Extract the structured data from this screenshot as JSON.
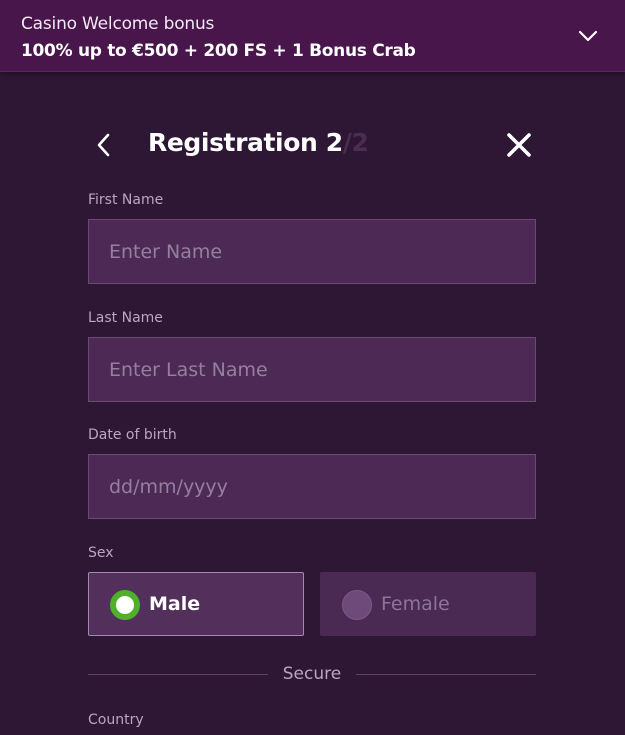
{
  "banner": {
    "title": "Casino Welcome bonus",
    "offer": "100% up to €500 + 200 FS + 1 Bonus Crab",
    "icon": "chevron-down-icon"
  },
  "header": {
    "title": "Registration",
    "step_current": "2",
    "step_total": "/2",
    "back_icon": "chevron-left-icon",
    "close_icon": "close-icon"
  },
  "form": {
    "first_name": {
      "label": "First Name",
      "placeholder": "Enter Name",
      "value": ""
    },
    "last_name": {
      "label": "Last Name",
      "placeholder": "Enter Last Name",
      "value": ""
    },
    "date_of_birth": {
      "label": "Date of birth",
      "placeholder": "dd/mm/yyyy",
      "value": ""
    },
    "sex": {
      "label": "Sex",
      "options": [
        {
          "label": "Male",
          "selected": true
        },
        {
          "label": "Female",
          "selected": false
        }
      ]
    },
    "secure_divider": "Secure",
    "country": {
      "label": "Country"
    }
  },
  "colors": {
    "background": "#2e1635",
    "banner": "#48164b",
    "input_bg": "#4c2a55",
    "radio_selected": "#4fb02a"
  }
}
